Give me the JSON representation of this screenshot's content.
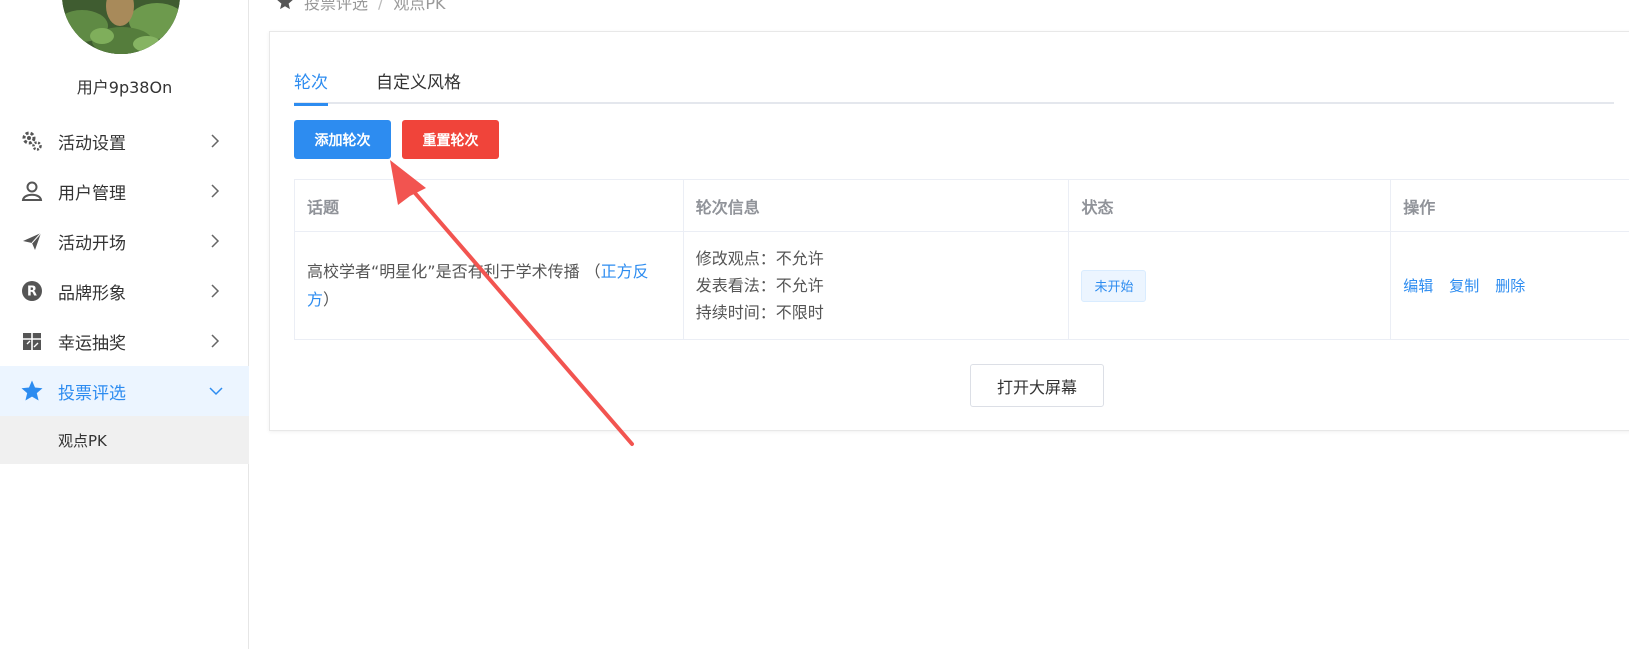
{
  "sidebar": {
    "username": "用户9p38On",
    "items": [
      {
        "label": "活动设置",
        "icon": "gears-icon"
      },
      {
        "label": "用户管理",
        "icon": "user-icon"
      },
      {
        "label": "活动开场",
        "icon": "paper-plane-icon"
      },
      {
        "label": "品牌形象",
        "icon": "registered-icon"
      },
      {
        "label": "幸运抽奖",
        "icon": "gift-icon"
      },
      {
        "label": "投票评选",
        "icon": "star-icon"
      }
    ],
    "submenu": [
      {
        "label": "观点PK"
      }
    ]
  },
  "breadcrumb": {
    "items": [
      "投票评选",
      "观点PK"
    ],
    "separator": "/"
  },
  "tabs": [
    {
      "label": "轮次",
      "active": true
    },
    {
      "label": "自定义风格",
      "active": false
    }
  ],
  "toolbar": {
    "add_label": "添加轮次",
    "reset_label": "重置轮次"
  },
  "table": {
    "headers": [
      "话题",
      "轮次信息",
      "状态",
      "操作"
    ],
    "rows": [
      {
        "topic": "高校学者“明星化”是否有利于学术传播 （",
        "topic_link": "正方反方",
        "topic_end": "）",
        "info": [
          "修改观点：不允许",
          "发表看法：不允许",
          "持续时间：不限时"
        ],
        "status": "未开始",
        "ops": [
          "编辑",
          "复制",
          "删除"
        ]
      }
    ]
  },
  "open_screen_label": "打开大屏幕",
  "colors": {
    "primary": "#2d8cf0",
    "danger": "#f0443a",
    "annotation_arrow": "#f25450"
  }
}
